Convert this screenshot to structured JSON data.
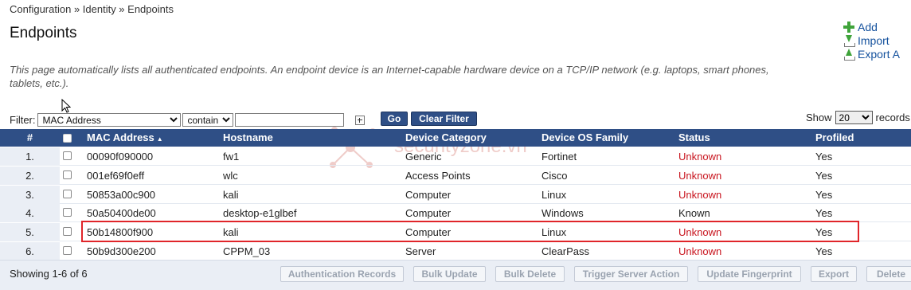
{
  "breadcrumb": "Configuration » Identity » Endpoints",
  "page_title": "Endpoints",
  "description": "This page automatically lists all authenticated endpoints. An endpoint device is an Internet-capable hardware device on a TCP/IP network (e.g. laptops, smart phones, tablets, etc.).",
  "actions": {
    "add": "Add",
    "import": "Import",
    "export": "Export A"
  },
  "filter": {
    "label": "Filter:",
    "field": "MAC Address",
    "operator": "contains",
    "value": "",
    "go": "Go",
    "clear": "Clear Filter",
    "show_label": "Show",
    "show_value": "20",
    "records_label": "records"
  },
  "table": {
    "headers": {
      "num": "#",
      "mac": "MAC Address",
      "host": "Hostname",
      "cat": "Device Category",
      "os": "Device OS Family",
      "status": "Status",
      "profiled": "Profiled"
    },
    "rows": [
      {
        "num": "1.",
        "mac": "00090f090000",
        "host": "fw1",
        "cat": "Generic",
        "os": "Fortinet",
        "status": "Unknown",
        "profiled": "Yes"
      },
      {
        "num": "2.",
        "mac": "001ef69f0eff",
        "host": "wlc",
        "cat": "Access Points",
        "os": "Cisco",
        "status": "Unknown",
        "profiled": "Yes"
      },
      {
        "num": "3.",
        "mac": "50853a00c900",
        "host": "kali",
        "cat": "Computer",
        "os": "Linux",
        "status": "Unknown",
        "profiled": "Yes"
      },
      {
        "num": "4.",
        "mac": "50a50400de00",
        "host": "desktop-e1glbef",
        "cat": "Computer",
        "os": "Windows",
        "status": "Known",
        "profiled": "Yes"
      },
      {
        "num": "5.",
        "mac": "50b14800f900",
        "host": "kali",
        "cat": "Computer",
        "os": "Linux",
        "status": "Unknown",
        "profiled": "Yes"
      },
      {
        "num": "6.",
        "mac": "50b9d300e200",
        "host": "CPPM_03",
        "cat": "Server",
        "os": "ClearPass",
        "status": "Unknown",
        "profiled": "Yes"
      }
    ]
  },
  "footer": {
    "showing": "Showing 1-6 of 6",
    "buttons": {
      "auth": "Authentication Records",
      "bulk_update": "Bulk Update",
      "bulk_delete": "Bulk Delete",
      "trigger": "Trigger Server Action",
      "fingerprint": "Update Fingerprint",
      "export": "Export",
      "delete": "Delete"
    }
  },
  "watermark": "securityzone.vn",
  "colors": {
    "header_bg": "#2f4f86",
    "unknown": "#c8141e",
    "link": "#14519d",
    "highlight": "#e0252a"
  }
}
